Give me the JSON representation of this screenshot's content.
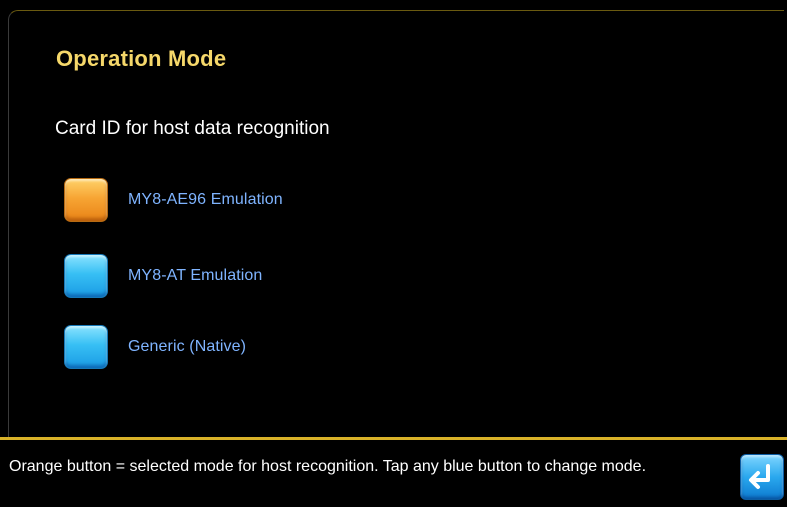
{
  "panel": {
    "title": "Operation Mode",
    "subtitle": "Card ID for host data recognition"
  },
  "modes": [
    {
      "label": "MY8-AE96 Emulation",
      "state": "selected",
      "color": "#f7a534"
    },
    {
      "label": "MY8-AT Emulation",
      "state": "unselected",
      "color": "#37bff4"
    },
    {
      "label": "Generic (Native)",
      "state": "unselected",
      "color": "#37bff4"
    }
  ],
  "status_bar": {
    "text": "Orange button = selected mode for host recognition. Tap any blue button to change mode.",
    "return_icon": "return-arrow-icon"
  },
  "colors": {
    "title": "#f6d86a",
    "option_label": "#7fb4ff",
    "divider": "#d9b229",
    "selected": "#f7a534",
    "unselected": "#37bff4"
  }
}
